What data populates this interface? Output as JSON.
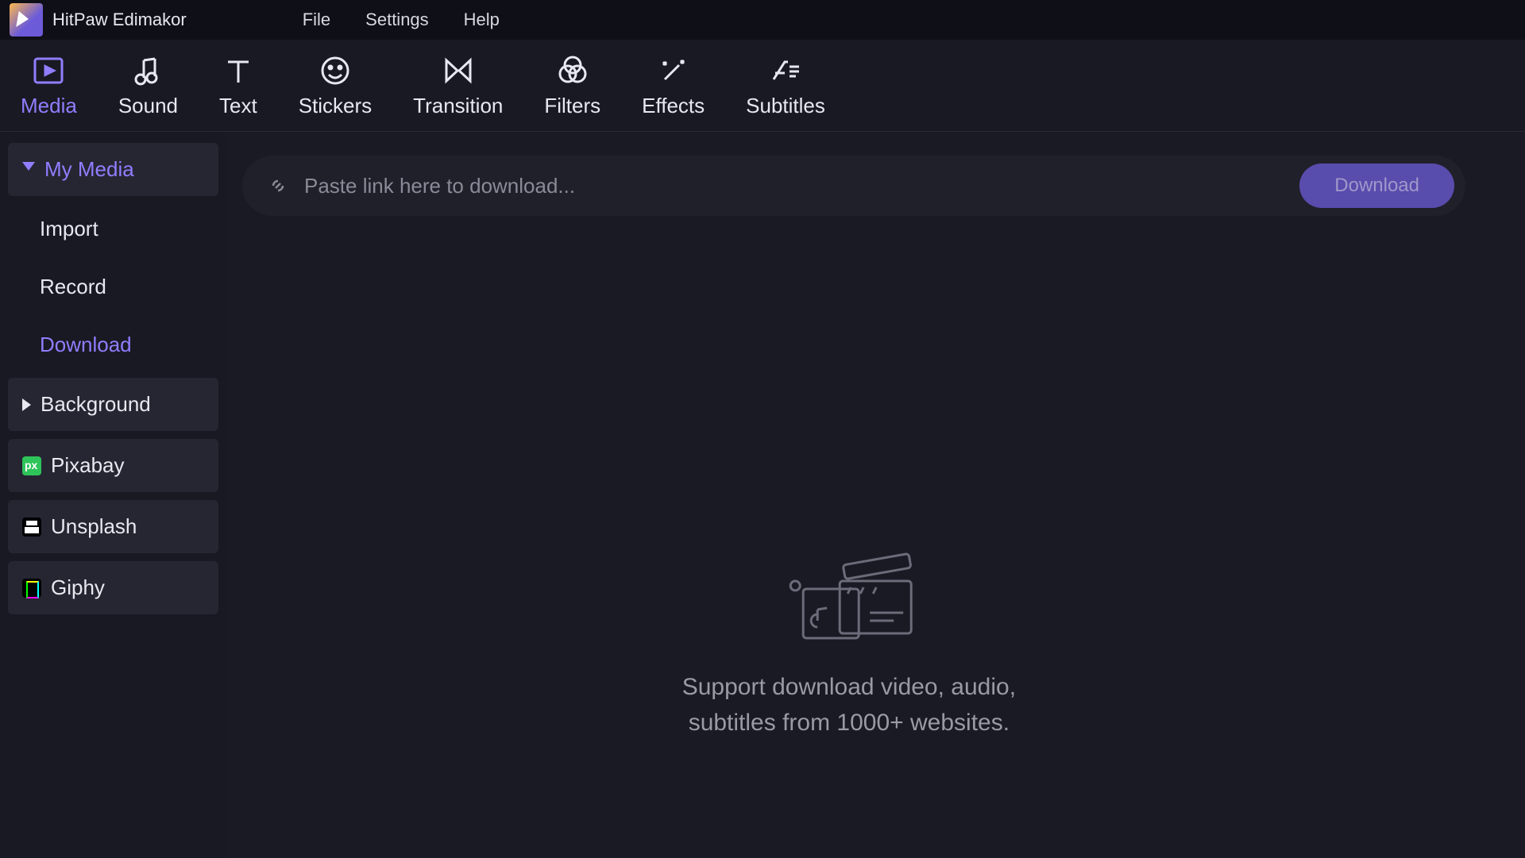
{
  "titlebar": {
    "app_title": "HitPaw Edimakor",
    "menu": {
      "file": "File",
      "settings": "Settings",
      "help": "Help"
    }
  },
  "toolbar": {
    "tabs": [
      {
        "label": "Media",
        "icon": "media-icon",
        "active": true
      },
      {
        "label": "Sound",
        "icon": "sound-icon"
      },
      {
        "label": "Text",
        "icon": "text-icon"
      },
      {
        "label": "Stickers",
        "icon": "stickers-icon"
      },
      {
        "label": "Transition",
        "icon": "transition-icon"
      },
      {
        "label": "Filters",
        "icon": "filters-icon"
      },
      {
        "label": "Effects",
        "icon": "effects-icon"
      },
      {
        "label": "Subtitles",
        "icon": "subtitles-icon"
      }
    ]
  },
  "sidebar": {
    "my_media": {
      "label": "My Media",
      "expanded": true
    },
    "subs": {
      "import": "Import",
      "record": "Record",
      "download": "Download"
    },
    "background": {
      "label": "Background",
      "expanded": false
    },
    "pixabay": "Pixabay",
    "unsplash": "Unsplash",
    "giphy": "Giphy"
  },
  "content": {
    "placeholder": "Paste link here to download...",
    "download_btn": "Download",
    "empty_line1": "Support download video, audio,",
    "empty_line2": "subtitles from 1000+ websites."
  },
  "colors": {
    "accent": "#8f7eff",
    "button": "#6b5bd9"
  }
}
